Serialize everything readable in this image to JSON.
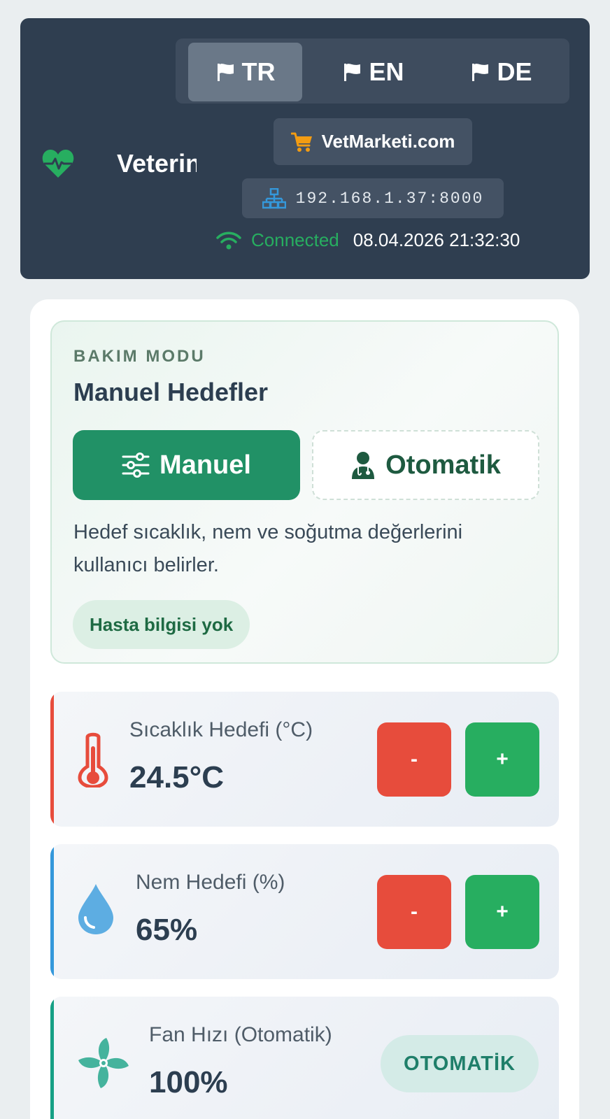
{
  "header": {
    "brand_name": "Veterin",
    "languages": [
      {
        "code": "TR",
        "active": true
      },
      {
        "code": "EN",
        "active": false
      },
      {
        "code": "DE",
        "active": false
      }
    ],
    "market_link": "VetMarketi.com",
    "ip_address": "192.168.1.37:8000",
    "connection_status": "Connected",
    "datetime": "08.04.2026 21:32:30",
    "icons": {
      "brand": "heart-pulse-icon",
      "flag": "flag-icon",
      "market": "shopping-cart-icon",
      "ip": "network-icon",
      "status": "wifi-icon"
    }
  },
  "care_mode": {
    "kicker": "BAKIM MODU",
    "title": "Manuel Hedefler",
    "manual_label": "Manuel",
    "automatic_label": "Otomatik",
    "selected": "Manuel",
    "description": "Hedef sıcaklık, nem ve soğutma değerlerini kullanıcı belirler.",
    "patient_status": "Hasta bilgisi yok"
  },
  "controls": {
    "temperature": {
      "label": "Sıcaklık Hedefi (°C)",
      "value": "24.5°C",
      "minus": "-",
      "plus": "+",
      "accent": "#e74c3c",
      "icon": "thermometer-icon"
    },
    "humidity": {
      "label": "Nem Hedefi (%)",
      "value": "65%",
      "minus": "-",
      "plus": "+",
      "accent": "#3498db",
      "icon": "water-drop-icon"
    },
    "fan": {
      "label": "Fan Hızı (Otomatik)",
      "value": "100%",
      "mode_badge": "OTOMATİK",
      "accent": "#16a085",
      "icon": "fan-icon"
    }
  },
  "colors": {
    "header_bg": "#2f3e50",
    "primary_green": "#219166",
    "success": "#27ae60",
    "danger": "#e74c3c"
  }
}
